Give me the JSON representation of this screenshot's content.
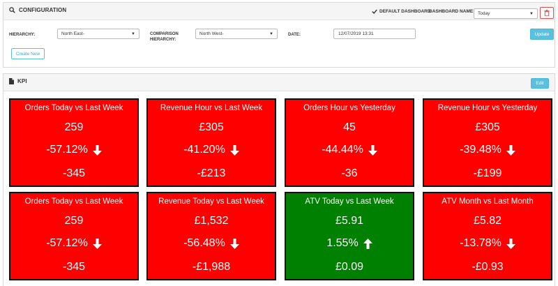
{
  "config": {
    "title": "CONFIGURATION",
    "default_dashboard_label": "DEFAULT DASHBOARD",
    "dashboard_name_label": "DASHBOARD NAME:",
    "dashboard_name_value": "Today",
    "hierarchy_label": "HIERARCHY:",
    "hierarchy_value": "North East-",
    "comparison_label": "COMPARISON HIERARCHY:",
    "comparison_value": "North West-",
    "date_label": "DATE:",
    "date_value": "12/07/2019 13:31",
    "update_label": "Update",
    "create_new_label": "Create New"
  },
  "kpi": {
    "title": "KPI",
    "edit_label": "Edit",
    "tiles": [
      {
        "title": "Orders Today vs Last Week",
        "value": "259",
        "pct": "-57.12%",
        "diff": "-345",
        "trend": "down",
        "color": "red"
      },
      {
        "title": "Revenue Hour vs Last Week",
        "value": "£305",
        "pct": "-41.20%",
        "diff": "-£213",
        "trend": "down",
        "color": "red"
      },
      {
        "title": "Orders Hour vs Yesterday",
        "value": "45",
        "pct": "-44.44%",
        "diff": "-36",
        "trend": "down",
        "color": "red"
      },
      {
        "title": "Revenue Hour vs Yesterday",
        "value": "£305",
        "pct": "-39.48%",
        "diff": "-£199",
        "trend": "down",
        "color": "red"
      },
      {
        "title": "Orders Today vs Last Week",
        "value": "259",
        "pct": "-57.12%",
        "diff": "-345",
        "trend": "down",
        "color": "red"
      },
      {
        "title": "Revenue Today vs Last Week",
        "value": "£1,532",
        "pct": "-56.48%",
        "diff": "-£1,988",
        "trend": "down",
        "color": "red"
      },
      {
        "title": "ATV Today vs Last Week",
        "value": "£5.91",
        "pct": "1.55%",
        "diff": "£0.09",
        "trend": "up",
        "color": "green"
      },
      {
        "title": "ATV Month vs Last Month",
        "value": "£5.82",
        "pct": "-13.78%",
        "diff": "-£0.93",
        "trend": "down",
        "color": "red"
      }
    ]
  },
  "colors": {
    "negative": "#ff0000",
    "positive": "#008000",
    "info_button": "#5bc0de",
    "danger": "#d9534f"
  }
}
